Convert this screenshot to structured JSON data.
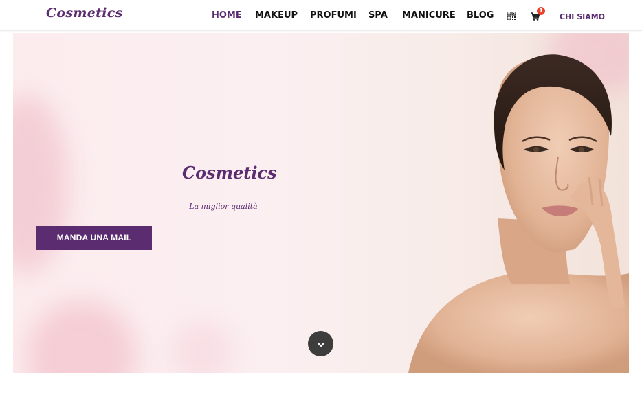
{
  "header": {
    "logo_text": "Cosmetics",
    "nav": [
      {
        "label": "HOME",
        "active": true
      },
      {
        "label": "MAKEUP",
        "active": false
      },
      {
        "label": "PROFUMI",
        "active": false
      },
      {
        "label": "SPA",
        "active": false
      },
      {
        "label": "MANICURE",
        "active": false
      },
      {
        "label": "BLOG",
        "active": false
      }
    ],
    "icons": {
      "qr": "qr-code-icon",
      "cart": "shopping-cart-icon"
    },
    "cart_count": "1",
    "chi_siamo": "CHI SIAMO"
  },
  "hero": {
    "title": "Cosmetics",
    "subtitle": "La miglior qualità",
    "button_label": "MANDA UNA MAIL",
    "scroll_icon": "chevron-down-icon",
    "image": "woman-portrait"
  },
  "colors": {
    "brand": "#5b2c6f",
    "badge": "#e8452c",
    "hero_bg": "#fbeff1",
    "scroll_button": "#3d3d3d"
  }
}
